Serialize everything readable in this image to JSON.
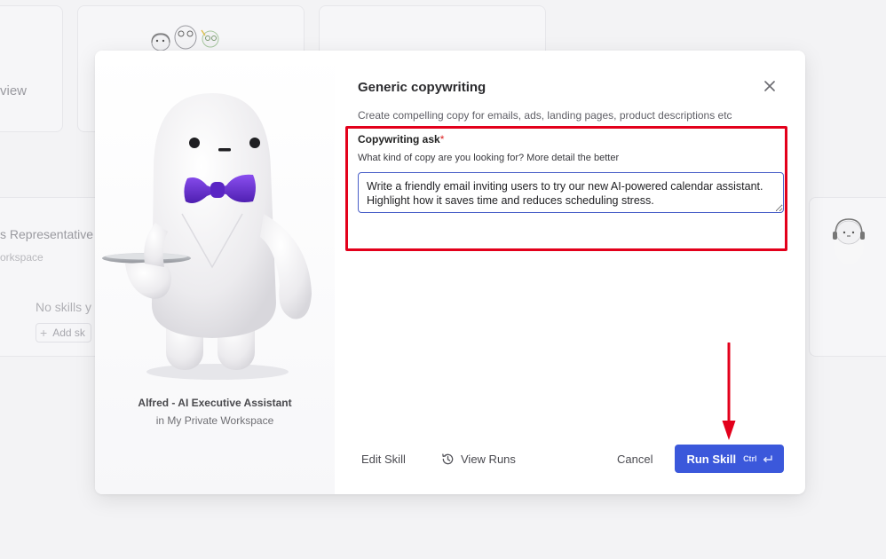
{
  "background": {
    "card_view_text": "view",
    "rep_title": "s Representative",
    "rep_subtitle": "orkspace",
    "no_skills_text": "No skills y",
    "add_skill_label": "Add sk"
  },
  "modal": {
    "title": "Generic copywriting",
    "description": "Create compelling copy for emails, ads, landing pages, product descriptions etc",
    "agent": {
      "name": "Alfred - AI Executive Assistant",
      "workspace": "in My Private Workspace"
    },
    "field": {
      "label": "Copywriting ask",
      "required_mark": "*",
      "help": "What kind of copy are you looking for? More detail the better",
      "value": "Write a friendly email inviting users to try our new AI-powered calendar assistant. Highlight how it saves time and reduces scheduling stress."
    },
    "footer": {
      "edit_skill_label": "Edit Skill",
      "view_runs_label": "View Runs",
      "cancel_label": "Cancel",
      "run_skill_label": "Run Skill",
      "run_skill_shortcut": "Ctrl"
    }
  },
  "colors": {
    "primary": "#3b58db",
    "highlight": "#e3001b",
    "bow_tie": "#6b2fd1"
  },
  "icons": {
    "close": "close-icon",
    "history": "history-icon",
    "enter": "enter-icon"
  }
}
